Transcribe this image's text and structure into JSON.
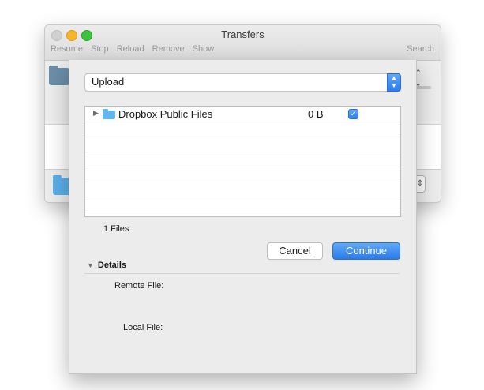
{
  "window": {
    "title": "Transfers",
    "toolbar": [
      "Resume",
      "Stop",
      "Reload",
      "Remove",
      "Show"
    ],
    "search_label": "Search"
  },
  "sheet": {
    "action_select": "Upload",
    "files": [
      {
        "name": "Dropbox Public Files",
        "size": "0 B",
        "checked": true
      }
    ],
    "empty_rows": 6,
    "file_count": "1 Files",
    "cancel_label": "Cancel",
    "continue_label": "Continue",
    "details": {
      "heading": "Details",
      "remote_label": "Remote File:",
      "local_label": "Local File:"
    }
  },
  "colors": {
    "accent": "#2d7ce9",
    "folder": "#62b7ef"
  }
}
